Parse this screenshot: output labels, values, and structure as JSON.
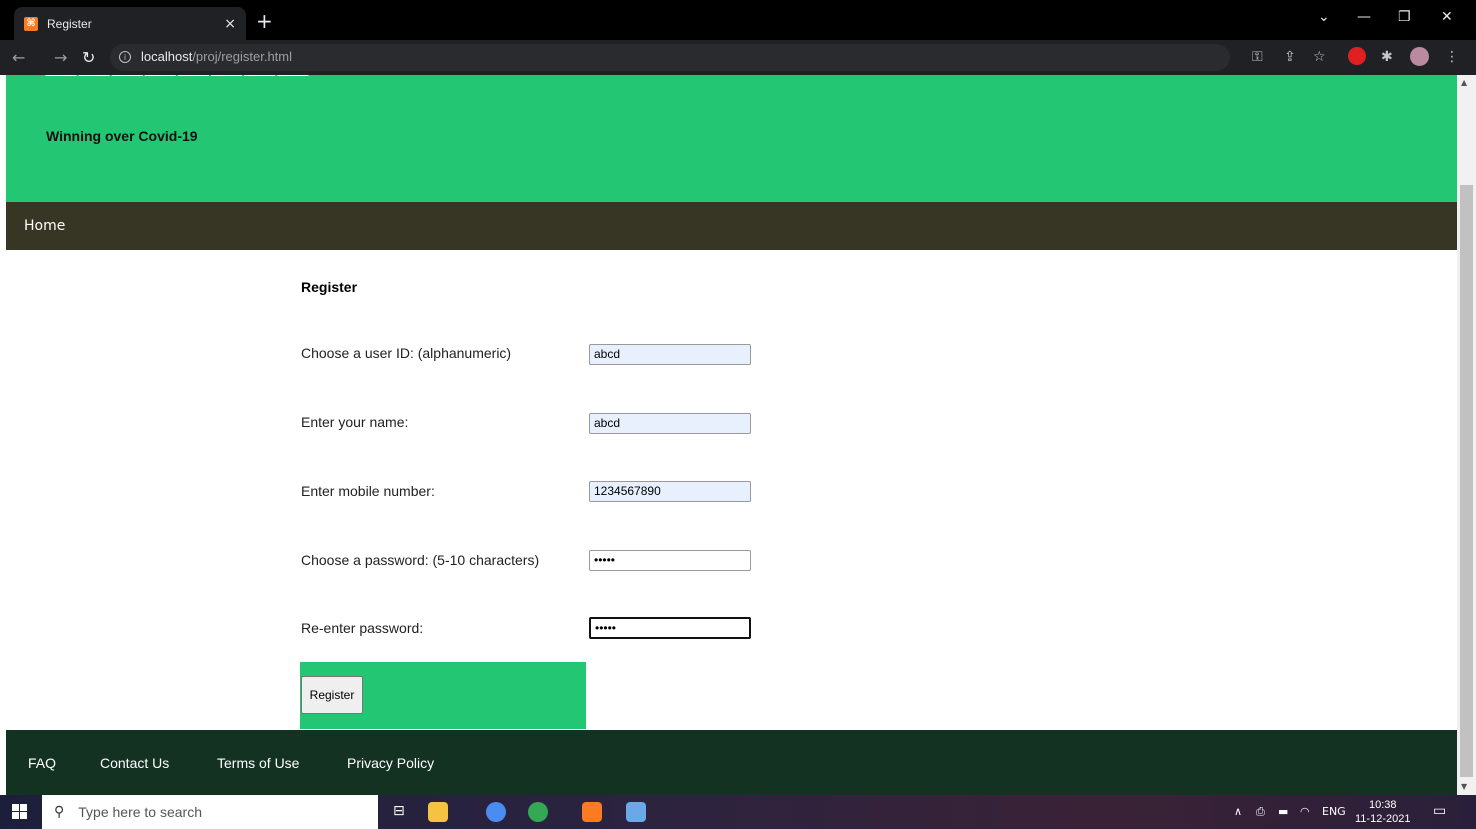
{
  "browser": {
    "tab_title": "Register",
    "tab_close": "×",
    "new_tab": "+",
    "url_host": "localhost",
    "url_path": "/proj/register.html"
  },
  "header": {
    "tagline": "Winning over Covid-19"
  },
  "nav": {
    "home": "Home"
  },
  "form": {
    "title": "Register",
    "fields": [
      {
        "label": "Choose a user ID: (alphanumeric)",
        "value": "abcd"
      },
      {
        "label": "Enter your name:",
        "value": "abcd"
      },
      {
        "label": "Enter mobile number:",
        "value": "1234567890"
      },
      {
        "label": "Choose a password: (5-10 characters)",
        "value": "•••••"
      },
      {
        "label": "Re-enter password:",
        "value": "•••••"
      }
    ],
    "submit_label": "Register"
  },
  "footer": {
    "links": [
      "FAQ",
      "Contact Us",
      "Terms of Use",
      "Privacy Policy"
    ]
  },
  "taskbar": {
    "search_placeholder": "Type here to search",
    "language": "ENG",
    "time": "10:38",
    "date": "11-12-2021"
  },
  "colors": {
    "header_green": "#22c673",
    "nav_dark": "#373524",
    "footer_dark": "#133222"
  }
}
